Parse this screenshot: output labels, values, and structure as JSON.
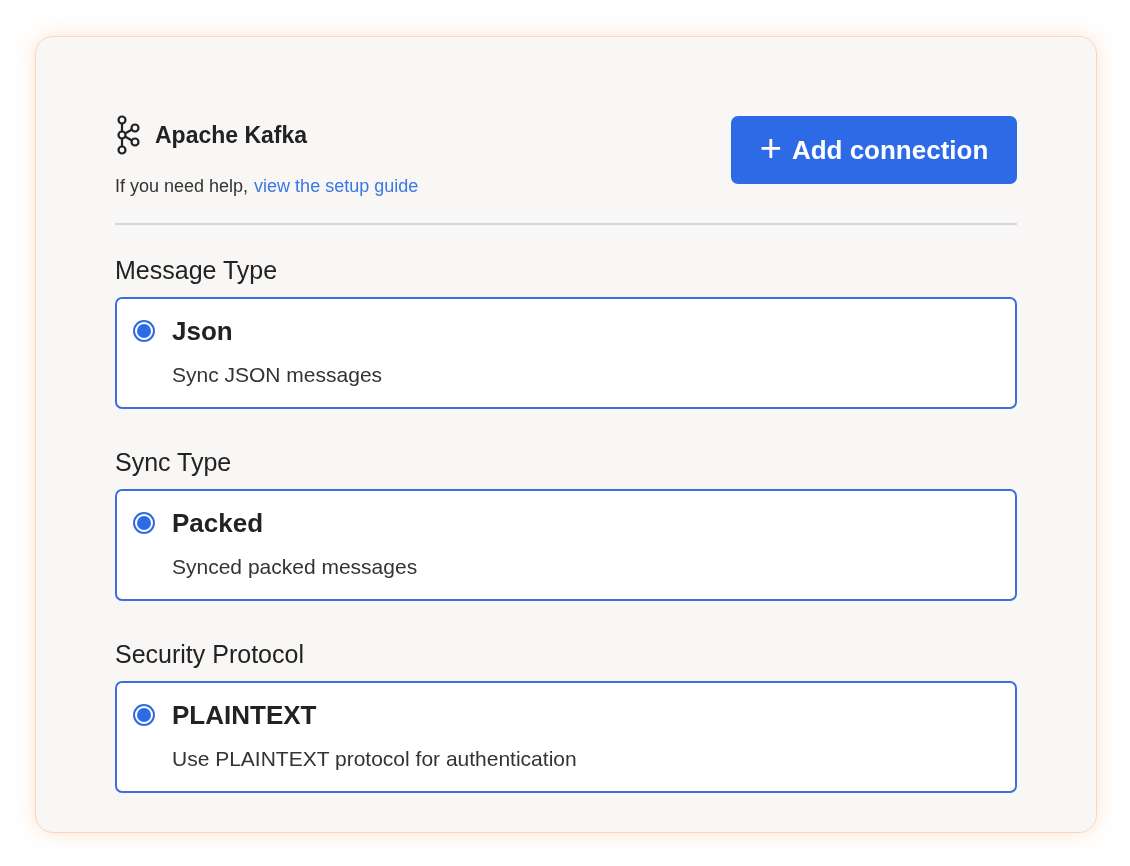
{
  "header": {
    "title": "Apache Kafka",
    "help_text": "If you need help,",
    "help_link": "view the setup guide",
    "button": {
      "icon": "+",
      "label": "Add connection"
    }
  },
  "sections": [
    {
      "label": "Message Type",
      "options": [
        {
          "title": "Json",
          "description": "Sync JSON messages",
          "selected": true
        }
      ]
    },
    {
      "label": "Sync Type",
      "options": [
        {
          "title": "Packed",
          "description": "Synced packed messages",
          "selected": true
        }
      ]
    },
    {
      "label": "Security Protocol",
      "options": [
        {
          "title": "PLAINTEXT",
          "description": "Use PLAINTEXT protocol for authentication",
          "selected": true
        }
      ]
    }
  ]
}
